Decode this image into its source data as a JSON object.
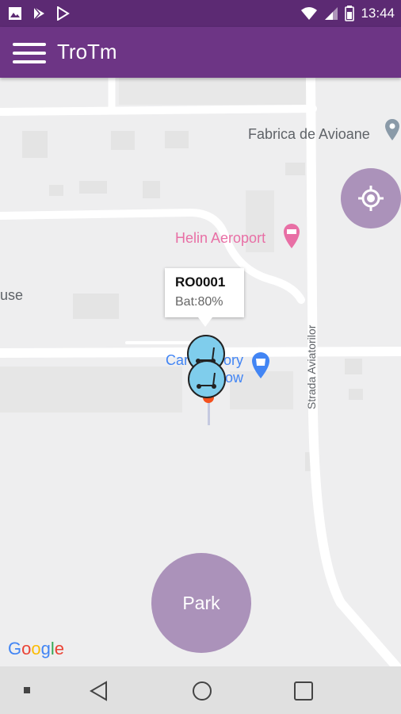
{
  "status_bar": {
    "time": "13:44",
    "left_icons": [
      "image-icon",
      "play-store-icon",
      "play-store-icon"
    ],
    "right_icons": [
      "wifi-icon",
      "signal-icon",
      "battery-icon"
    ]
  },
  "app_bar": {
    "title": "TroTm",
    "menu_icon": "hamburger-menu-icon"
  },
  "map": {
    "labels": {
      "fabrica": "Fabrica de Avioane",
      "helin": "Helin Aeroport",
      "house_partial": "use",
      "car_factory_line1": "Car",
      "car_factory_line1_end": "ory",
      "car_factory_line2": "ow",
      "street": "Strada Aviatorilor"
    },
    "colors": {
      "poi_gray": "#5f6368",
      "poi_pink": "#e86fa5",
      "poi_blue": "#4285f4"
    }
  },
  "info_window": {
    "title": "RO0001",
    "subtitle": "Bat:80%"
  },
  "markers": {
    "scooter_count": 2,
    "scooter_icon": "scooter-icon",
    "scooter_color": "#7fcdec",
    "user_pin_color": "#f4511e"
  },
  "park_button": {
    "label": "Park",
    "color": "#ab92ba"
  },
  "locate_button": {
    "icon": "my-location-icon",
    "color": "#ab92ba"
  },
  "google_logo": {
    "letters": [
      "G",
      "o",
      "o",
      "g",
      "l",
      "e"
    ],
    "colors": [
      "#4285f4",
      "#ea4335",
      "#fbbc05",
      "#4285f4",
      "#34a853",
      "#ea4335"
    ]
  },
  "nav_bar": {
    "icons": [
      "square-dot-icon",
      "back-icon",
      "home-icon",
      "recents-icon"
    ]
  },
  "brand": {
    "primary_dark": "#5c2a73",
    "primary": "#6d3585"
  }
}
